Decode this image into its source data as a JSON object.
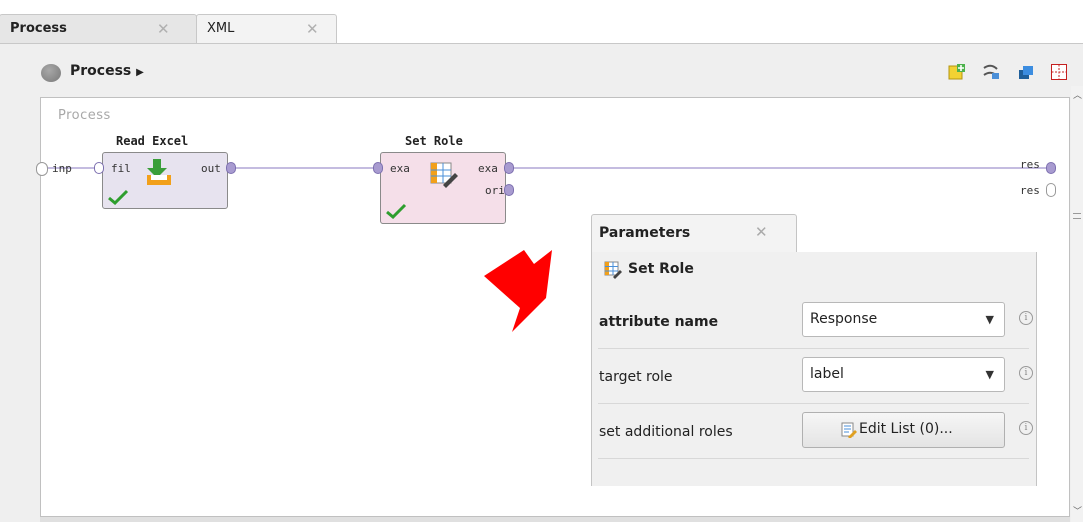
{
  "tabs": [
    {
      "label": "Process",
      "close": "✕"
    },
    {
      "label": "XML",
      "close": "✕"
    }
  ],
  "breadcrumb": {
    "label": "Process",
    "arrow": "▶"
  },
  "toolbar_icons": [
    "add-note-icon",
    "auto-wire-icon",
    "layers-icon",
    "grid-icon"
  ],
  "canvas": {
    "label": "Process",
    "input_port": "inp",
    "result_ports": [
      "res",
      "res"
    ]
  },
  "operators": {
    "read_excel": {
      "title": "Read Excel",
      "in_port": "fil",
      "out_port": "out"
    },
    "set_role": {
      "title": "Set Role",
      "in_port": "exa",
      "out_ports": [
        "exa",
        "ori"
      ]
    }
  },
  "parameters": {
    "tab_label": "Parameters",
    "tab_close": "✕",
    "operator": "Set Role",
    "rows": [
      {
        "label": "attribute name",
        "value": "Response",
        "bold": true,
        "control": "combo"
      },
      {
        "label": "target role",
        "value": "label",
        "bold": false,
        "control": "combo"
      },
      {
        "label": "set additional roles",
        "value": "Edit List (0)...",
        "bold": false,
        "control": "button"
      }
    ],
    "info_glyph": "i"
  },
  "annotation": {
    "color": "#ff0000",
    "shape": "arrow"
  }
}
